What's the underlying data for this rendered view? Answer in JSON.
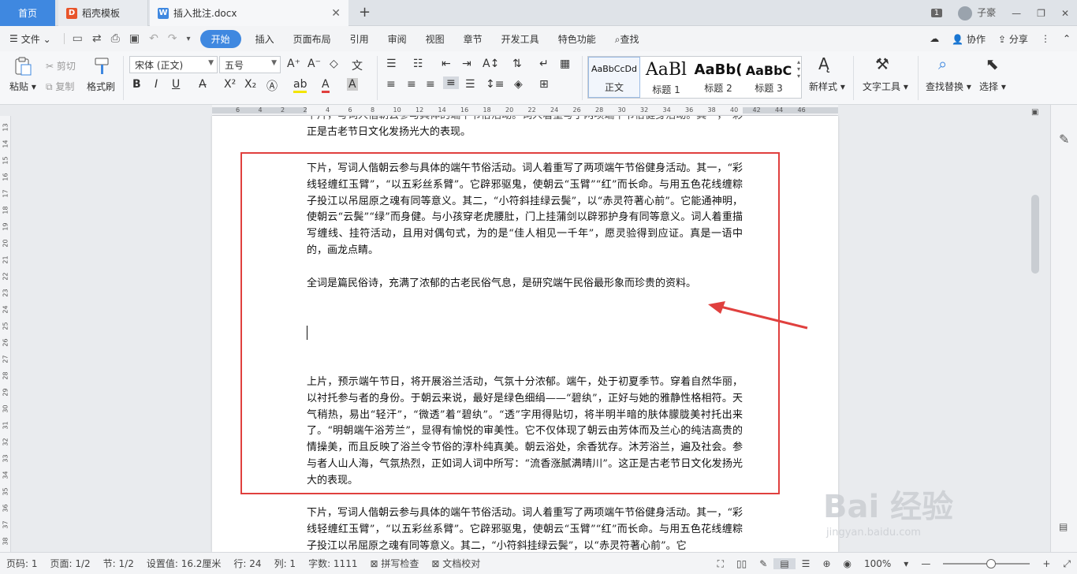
{
  "tabs": [
    {
      "label": "首页"
    },
    {
      "label": "稻壳模板"
    },
    {
      "label": "插入批注.docx"
    }
  ],
  "tabbar_right": {
    "badge": "1",
    "user": "子豪"
  },
  "menu": {
    "file": "文件",
    "items": [
      "开始",
      "插入",
      "页面布局",
      "引用",
      "审阅",
      "视图",
      "章节",
      "开发工具",
      "特色功能"
    ],
    "search": "查找",
    "collab": "协作",
    "share": "分享"
  },
  "ribbon": {
    "paste": "粘贴",
    "cut": "剪切",
    "copy": "复制",
    "format_painter": "格式刷",
    "font": "宋体 (正文)",
    "size": "五号",
    "styles": [
      {
        "preview": "AaBbCcDd",
        "label": "正文"
      },
      {
        "preview": "AaBl",
        "label": "标题 1"
      },
      {
        "preview": "AaBb(",
        "label": "标题 2"
      },
      {
        "preview": "AaBbC",
        "label": "标题 3"
      }
    ],
    "new_style": "新样式",
    "text_tools": "文字工具",
    "find_replace": "查找替换",
    "select": "选择"
  },
  "hruler_ticks": [
    "6",
    "4",
    "2",
    "2",
    "4",
    "6",
    "8",
    "10",
    "12",
    "14",
    "16",
    "18",
    "20",
    "22",
    "24",
    "26",
    "28",
    "30",
    "32",
    "34",
    "36",
    "38",
    "40",
    "42",
    "44",
    "46"
  ],
  "vruler_ticks": [
    "13",
    "14",
    "15",
    "16",
    "17",
    "18",
    "19",
    "20",
    "21",
    "22",
    "23",
    "24",
    "25",
    "26",
    "27",
    "28",
    "29",
    "30",
    "31",
    "32",
    "33",
    "34",
    "35",
    "36",
    "37",
    "38"
  ],
  "document": {
    "top_fragment": "正是古老节日文化发扬光大的表现。",
    "para1": "下片，写词人偕朝云参与具体的端午节俗活动。词人着重写了两项端午节俗健身活动。其一，“彩线轻缠红玉臂”，“以五彩丝系臂”。它辟邪驱鬼，使朝云“玉臂”“红”而长命。与用五色花线缠粽子投江以吊屈原之魂有同等意义。其二，“小符斜挂绿云鬓”，以“赤灵符著心前”。它能通神明，使朝云“云鬓”“绿”而身健。与小孩穿老虎腰肚，门上挂蒲剑以辟邪护身有同等意义。词人着重描写缠线、挂符活动，且用对偶句式，为的是“佳人相见一千年”，愿灵验得到应证。真是一语中的，画龙点睛。",
    "para2": "全词是篇民俗诗，充满了浓郁的古老民俗气息，是研究端午民俗最形象而珍贵的资料。",
    "para3": "上片，预示端午节日，将开展浴兰活动，气氛十分浓郁。端午，处于初夏季节。穿着自然华丽，以衬托参与者的身份。于朝云来说，最好是绿色细绢——“碧纨”，正好与她的雅静性格相符。天气稍热，易出“轻汗”，“微透”着“碧纨”。“透”字用得贴切，将半明半暗的肤体朦胧美衬托出来了。“明朝端午浴芳兰”，显得有愉悦的审美性。它不仅体现了朝云由芳体而及兰心的纯洁高贵的情操美，而且反映了浴兰令节俗的淳朴纯真美。朝云浴处，余香犹存。沐芳浴兰，遍及社会。参与者人山人海，气氛热烈，正如词人词中所写：“流香涨腻满晴川”。这正是古老节日文化发扬光大的表现。",
    "para4": "下片，写词人偕朝云参与具体的端午节俗活动。词人着重写了两项端午节俗健身活动。其一，“彩线轻缠红玉臂”，“以五彩丝系臂”。它辟邪驱鬼，使朝云“玉臂”“红”而长命。与用五色花线缠粽子投江以吊屈原之魂有同等意义。其二，“小符斜挂绿云鬓”，以“赤灵符著心前”。它"
  },
  "status": {
    "page": "页码: 1",
    "pages": "页面: 1/2",
    "section": "节: 1/2",
    "setting": "设置值: 16.2厘米",
    "row": "行: 24",
    "col": "列: 1",
    "words": "字数: 1111",
    "spell": "拼写检查",
    "proof": "文档校对",
    "zoom": "100%"
  },
  "watermark": {
    "big": "Bai 经验",
    "small": "jingyan.baidu.com"
  },
  "colors": {
    "accent": "#3f88e0",
    "highlight_box": "#e0403e"
  }
}
